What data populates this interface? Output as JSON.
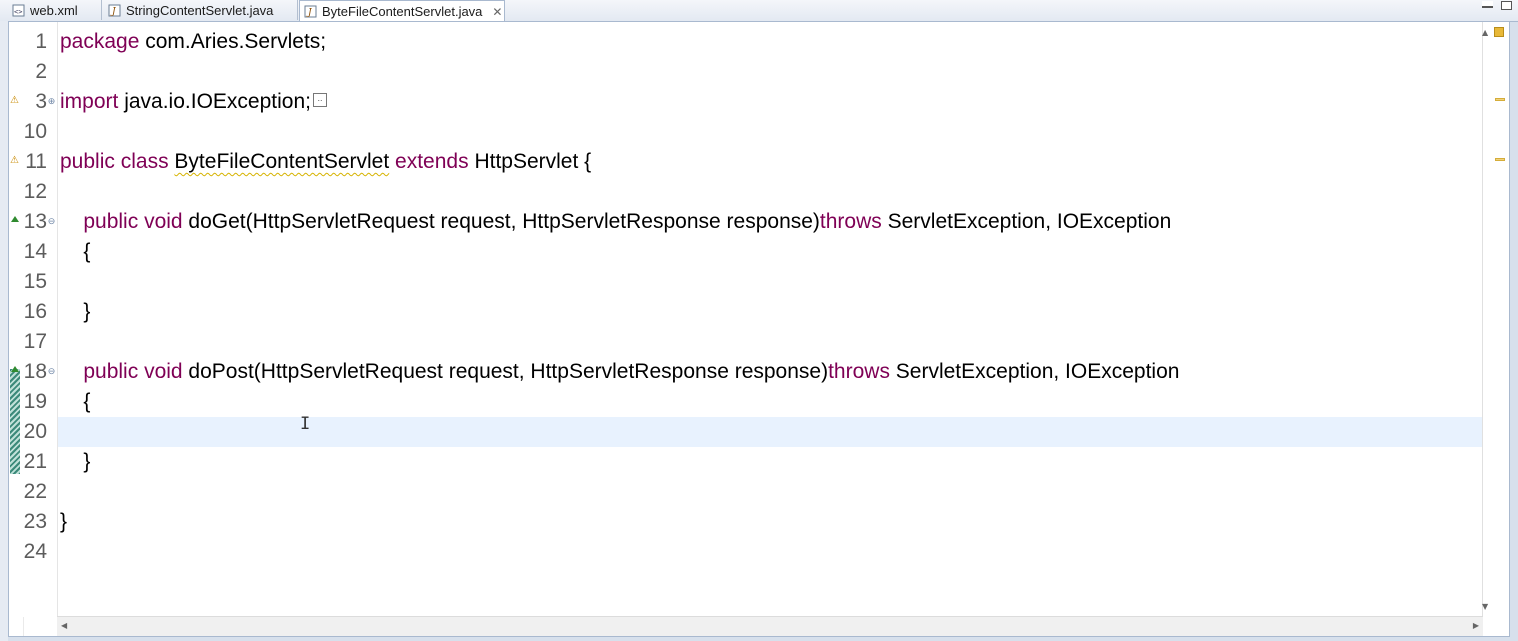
{
  "tabs": [
    {
      "label": "web.xml",
      "icon": "xml-file-icon",
      "active": false
    },
    {
      "label": "StringContentServlet.java",
      "icon": "java-file-icon",
      "active": false
    },
    {
      "label": "ByteFileContentServlet.java",
      "icon": "java-file-icon",
      "active": true,
      "close_icon": "close-icon"
    }
  ],
  "colors": {
    "keyword": "#7f0055",
    "current_line": "#e8f2fe",
    "line_number": "#5c5c5c"
  },
  "lines": [
    {
      "num": "1",
      "parts": [
        [
          "kw",
          "package"
        ],
        [
          "t",
          " com.Aries.Servlets;"
        ]
      ]
    },
    {
      "num": "2",
      "parts": []
    },
    {
      "num": "3",
      "parts": [
        [
          "kw",
          "import"
        ],
        [
          "t",
          " java.io.IOException;"
        ]
      ],
      "collapsed": true,
      "warning": true,
      "fold": "expand"
    },
    {
      "num": "10",
      "parts": []
    },
    {
      "num": "11",
      "parts": [
        [
          "kw",
          "public"
        ],
        [
          "t",
          " "
        ],
        [
          "kw",
          "class"
        ],
        [
          "t",
          " "
        ],
        [
          "warn",
          "ByteFileContentServlet"
        ],
        [
          "t",
          " "
        ],
        [
          "kw",
          "extends"
        ],
        [
          "t",
          " HttpServlet {"
        ]
      ],
      "warning": true
    },
    {
      "num": "12",
      "parts": []
    },
    {
      "num": "13",
      "parts": [
        [
          "t",
          "    "
        ],
        [
          "kw",
          "public"
        ],
        [
          "t",
          " "
        ],
        [
          "kw",
          "void"
        ],
        [
          "t",
          " doGet(HttpServletRequest request, HttpServletResponse response)"
        ],
        [
          "kw",
          "throws"
        ],
        [
          "t",
          " ServletException, IOException"
        ]
      ],
      "override": true,
      "fold": "collapse"
    },
    {
      "num": "14",
      "parts": [
        [
          "t",
          "    {"
        ]
      ]
    },
    {
      "num": "15",
      "parts": []
    },
    {
      "num": "16",
      "parts": [
        [
          "t",
          "    }"
        ]
      ]
    },
    {
      "num": "17",
      "parts": []
    },
    {
      "num": "18",
      "parts": [
        [
          "t",
          "    "
        ],
        [
          "kw",
          "public"
        ],
        [
          "t",
          " "
        ],
        [
          "kw",
          "void"
        ],
        [
          "t",
          " doPost(HttpServletRequest request, HttpServletResponse response)"
        ],
        [
          "kw",
          "throws"
        ],
        [
          "t",
          " ServletException, IOException"
        ]
      ],
      "override": true,
      "fold": "collapse"
    },
    {
      "num": "19",
      "parts": [
        [
          "t",
          "    {"
        ]
      ]
    },
    {
      "num": "20",
      "parts": [],
      "current": true
    },
    {
      "num": "21",
      "parts": [
        [
          "t",
          "    }"
        ]
      ]
    },
    {
      "num": "22",
      "parts": []
    },
    {
      "num": "23",
      "parts": [
        [
          "t",
          "}"
        ]
      ]
    },
    {
      "num": "24",
      "parts": []
    }
  ]
}
